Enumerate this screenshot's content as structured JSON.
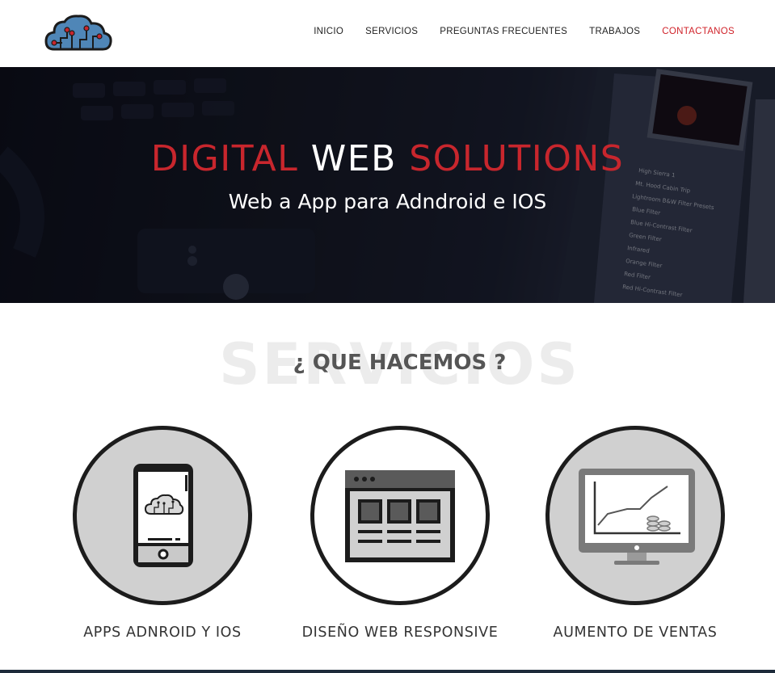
{
  "header": {
    "logo_name": "cloud-circuit-logo",
    "nav": [
      {
        "label": "INICIO"
      },
      {
        "label": "SERVICIOS"
      },
      {
        "label": "PREGUNTAS FRECUENTES"
      },
      {
        "label": "TRABAJOS"
      },
      {
        "label": "CONTACTANOS"
      }
    ]
  },
  "hero": {
    "title_part1": "DIGITAL",
    "title_part2": "WEB",
    "title_part3": "SOLUTIONS",
    "subtitle": "Web a App para Adndroid e IOS"
  },
  "section": {
    "background_text": "SERVICIOS",
    "title": "¿ QUE HACEMOS ?"
  },
  "services": [
    {
      "label": "APPS ADNROID Y IOS",
      "icon": "smartphone-icon"
    },
    {
      "label": "DISEÑO WEB RESPONSIVE",
      "icon": "browser-window-icon"
    },
    {
      "label": "AUMENTO DE VENTAS",
      "icon": "monitor-chart-icon"
    }
  ],
  "colors": {
    "accent": "#c8262d",
    "dark": "#1c1c1c",
    "circle_gray": "#d0d0d0"
  }
}
